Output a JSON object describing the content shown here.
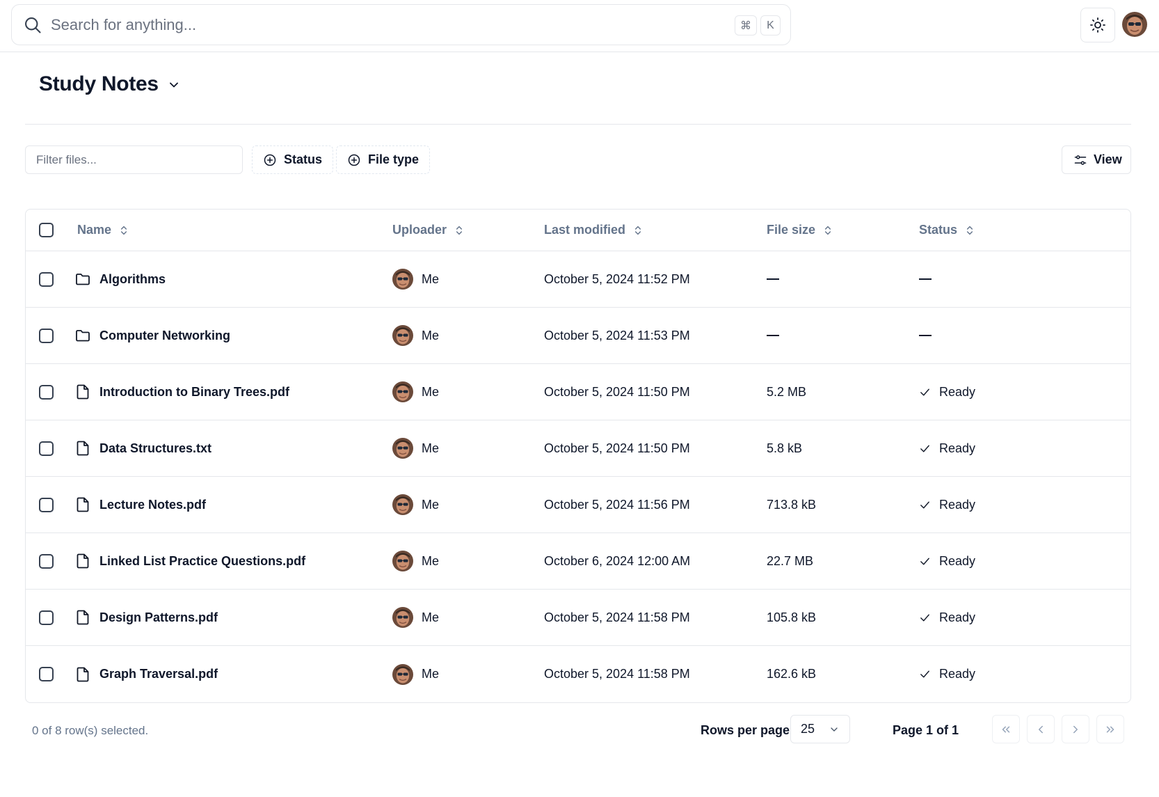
{
  "search": {
    "placeholder": "Search for anything...",
    "shortcut_keys": [
      "⌘",
      "K"
    ]
  },
  "header": {
    "theme_toggle_icon": "sun-icon",
    "user_avatar": "avatar"
  },
  "page": {
    "title": "Study Notes"
  },
  "toolbar": {
    "filter_placeholder": "Filter files...",
    "status_filter_label": "Status",
    "file_type_filter_label": "File type",
    "view_label": "View"
  },
  "table": {
    "columns": [
      "Name",
      "Uploader",
      "Last modified",
      "File size",
      "Status"
    ],
    "rows": [
      {
        "type": "folder",
        "name": "Algorithms",
        "uploader": "Me",
        "modified": "October 5, 2024 11:52 PM",
        "size": "—",
        "status": "—"
      },
      {
        "type": "folder",
        "name": "Computer Networking",
        "uploader": "Me",
        "modified": "October 5, 2024 11:53 PM",
        "size": "—",
        "status": "—"
      },
      {
        "type": "file",
        "name": "Introduction to Binary Trees.pdf",
        "uploader": "Me",
        "modified": "October 5, 2024 11:50 PM",
        "size": "5.2 MB",
        "status": "Ready"
      },
      {
        "type": "file",
        "name": "Data Structures.txt",
        "uploader": "Me",
        "modified": "October 5, 2024 11:50 PM",
        "size": "5.8 kB",
        "status": "Ready"
      },
      {
        "type": "file",
        "name": "Lecture Notes.pdf",
        "uploader": "Me",
        "modified": "October 5, 2024 11:56 PM",
        "size": "713.8 kB",
        "status": "Ready"
      },
      {
        "type": "file",
        "name": "Linked List Practice Questions.pdf",
        "uploader": "Me",
        "modified": "October 6, 2024 12:00 AM",
        "size": "22.7 MB",
        "status": "Ready"
      },
      {
        "type": "file",
        "name": "Design Patterns.pdf",
        "uploader": "Me",
        "modified": "October 5, 2024 11:58 PM",
        "size": "105.8 kB",
        "status": "Ready"
      },
      {
        "type": "file",
        "name": "Graph Traversal.pdf",
        "uploader": "Me",
        "modified": "October 5, 2024 11:58 PM",
        "size": "162.6 kB",
        "status": "Ready"
      }
    ]
  },
  "footer": {
    "selection_text": "0 of 8 row(s) selected.",
    "rows_per_page_label": "Rows per page",
    "rows_per_page_value": "25",
    "page_text": "Page 1 of 1"
  }
}
